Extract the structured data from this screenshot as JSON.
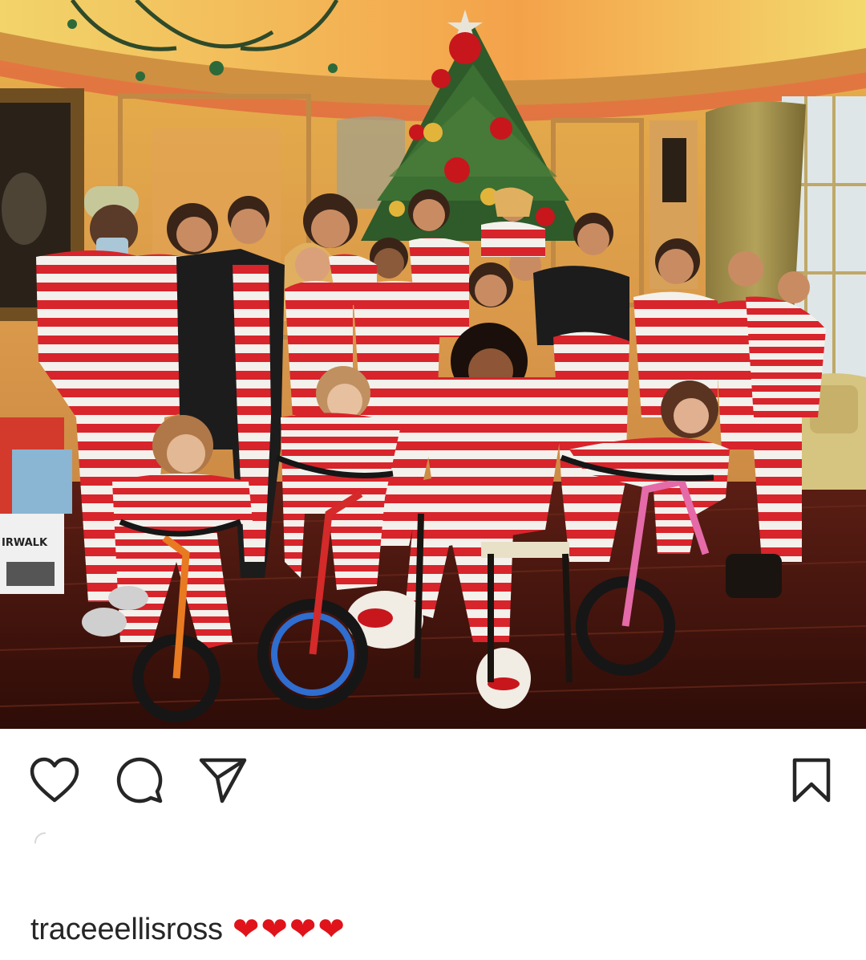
{
  "post": {
    "image_alt": "Family Christmas photo in matching red and white striped pajamas in front of a Christmas tree",
    "caption_username": "traceeellisross",
    "caption_text": "❤❤❤❤"
  },
  "actions": {
    "like_icon": "heart-outline-icon",
    "comment_icon": "speech-bubble-icon",
    "share_icon": "paper-plane-icon",
    "save_icon": "bookmark-outline-icon"
  },
  "colors": {
    "icon": "#262626",
    "text": "#262626",
    "heart_emoji": "#e0131a",
    "stripe_red": "#d8242b",
    "stripe_white": "#f4f1ec"
  }
}
